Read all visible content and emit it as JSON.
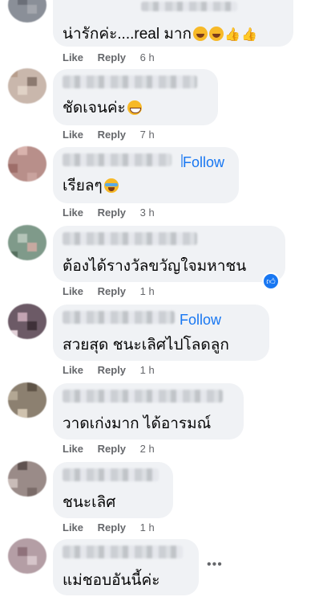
{
  "comments": [
    {
      "text": "น่ารักค่ะ....real มาก",
      "like": "Like",
      "reply": "Reply",
      "time": "6 h"
    },
    {
      "text": "ชัดเจนค่ะ",
      "like": "Like",
      "reply": "Reply",
      "time": "7 h"
    },
    {
      "text": "เรียลๆ",
      "follow": "Follow",
      "like": "Like",
      "reply": "Reply",
      "time": "3 h"
    },
    {
      "text": "ต้องได้รางวัลขวัญใจมหาชน",
      "like": "Like",
      "reply": "Reply",
      "time": "1 h"
    },
    {
      "text": "สวยสุด ชนะเลิศไปโลดลูก",
      "follow": "Follow",
      "like": "Like",
      "reply": "Reply",
      "time": "1 h"
    },
    {
      "text": "วาดเก่งมาก ได้อารมณ์",
      "like": "Like",
      "reply": "Reply",
      "time": "2 h"
    },
    {
      "text": "ชนะเลิศ",
      "like": "Like",
      "reply": "Reply",
      "time": "1 h"
    },
    {
      "text": "แม่ชอบอันนี้ค่ะ"
    }
  ],
  "icons": {
    "like_badge": "thumbs-up-icon",
    "more": "more-options-icon"
  },
  "colors": {
    "bubble": "#f0f2f5",
    "link": "#1877f2",
    "meta": "#65676b"
  }
}
